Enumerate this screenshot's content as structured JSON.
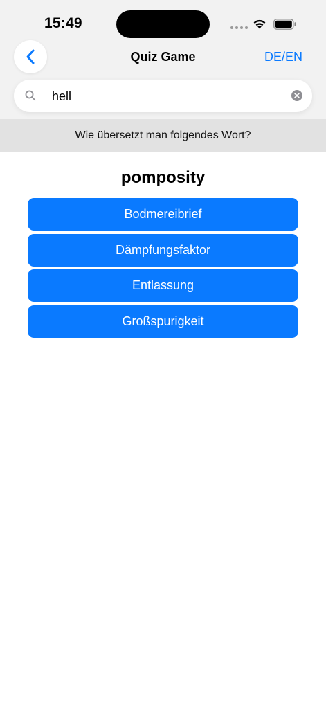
{
  "status_bar": {
    "time": "15:49"
  },
  "nav": {
    "title": "Quiz Game",
    "language_toggle": "DE/EN",
    "back_icon": "chevron-left-icon"
  },
  "search": {
    "value": "hell",
    "placeholder": "",
    "icon": "search-icon",
    "clear_icon": "clear-icon"
  },
  "quiz": {
    "prompt": "Wie übersetzt man folgendes Wort?",
    "word": "pomposity",
    "answers": [
      {
        "label": "Bodmereibrief"
      },
      {
        "label": "Dämpfungsfaktor"
      },
      {
        "label": "Entlassung"
      },
      {
        "label": "Großspurigkeit"
      }
    ]
  },
  "colors": {
    "accent": "#0a7aff",
    "header_background": "#f2f2f2",
    "prompt_band": "#e2e2e2"
  }
}
